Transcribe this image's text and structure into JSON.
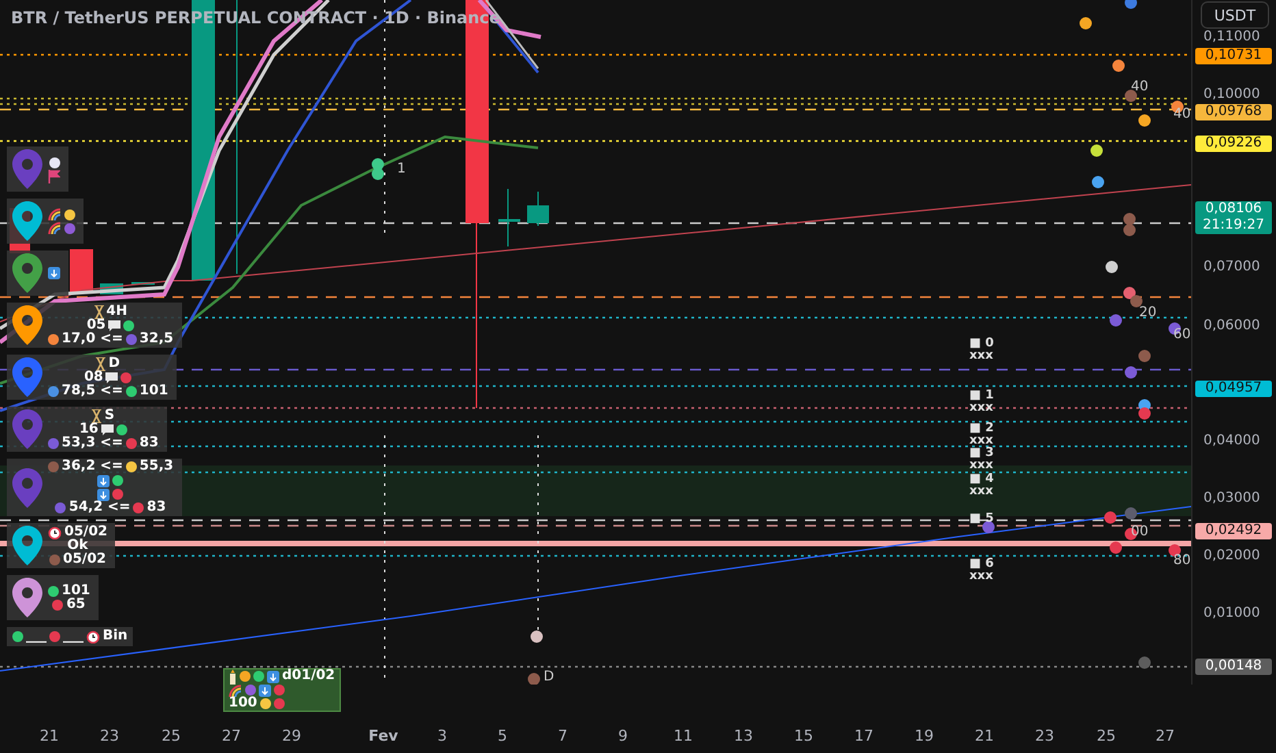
{
  "title": "BTR / TetherUS PERPETUAL CONTRACT · 1D · Binance",
  "currency": "USDT",
  "yticks": [
    "0,11000",
    "0,10000",
    "0,07000",
    "0,06000",
    "0,04000",
    "0,03000",
    "0,02000",
    "0,01000"
  ],
  "price_tags": [
    {
      "text": "0,10731",
      "color": "#ff9800",
      "dark_text": true
    },
    {
      "text": "0,09768",
      "color": "#f6b73c",
      "dark_text": true
    },
    {
      "text": "0,09226",
      "color": "#ffeb3b",
      "dark_text": true
    },
    {
      "text": "0,08106",
      "sub": "21:19:27",
      "color": "#089981",
      "dark_text": false
    },
    {
      "text": "0,04957",
      "color": "#00bcd4",
      "dark_text": true
    },
    {
      "text": "0,02492",
      "color": "#f7a9a8",
      "dark_text": true
    },
    {
      "text": "0,00148",
      "color": "#5d5d5d",
      "dark_text": false
    }
  ],
  "xticks": [
    {
      "label": "21",
      "kind": "day"
    },
    {
      "label": "23",
      "kind": "day"
    },
    {
      "label": "25",
      "kind": "day"
    },
    {
      "label": "27",
      "kind": "day"
    },
    {
      "label": "29",
      "kind": "day"
    },
    {
      "label": "Fev",
      "kind": "month"
    },
    {
      "label": "3",
      "kind": "day"
    },
    {
      "label": "5",
      "kind": "day"
    },
    {
      "label": "7",
      "kind": "day"
    },
    {
      "label": "9",
      "kind": "day"
    },
    {
      "label": "11",
      "kind": "day"
    },
    {
      "label": "13",
      "kind": "day"
    },
    {
      "label": "15",
      "kind": "day"
    },
    {
      "label": "17",
      "kind": "day"
    },
    {
      "label": "19",
      "kind": "day"
    },
    {
      "label": "21",
      "kind": "day"
    },
    {
      "label": "23",
      "kind": "day"
    },
    {
      "label": "25",
      "kind": "day"
    },
    {
      "label": "27",
      "kind": "day"
    }
  ],
  "panels": [
    {
      "color": "#6a3fc0",
      "rows": [
        [
          {
            "kind": "dot",
            "color": "#e6e6f5"
          }
        ],
        [
          {
            "kind": "flag"
          }
        ]
      ]
    },
    {
      "color": "#00bcd4",
      "rows": [
        [
          {
            "kind": "rainbow"
          },
          {
            "kind": "dot",
            "color": "#f5c542"
          }
        ],
        [
          {
            "kind": "rainbow"
          },
          {
            "kind": "dot",
            "color": "#8e5bd6"
          }
        ]
      ]
    },
    {
      "color": "#43a047",
      "rows": [
        [
          {
            "kind": "square"
          }
        ]
      ]
    },
    {
      "color": "#ff9800",
      "rows": [
        [
          {
            "kind": "hourglass"
          },
          {
            "kind": "text",
            "text": "4H"
          }
        ],
        [
          {
            "kind": "text",
            "text": "05"
          },
          {
            "kind": "chat"
          },
          {
            "kind": "dot",
            "color": "#2ecc71"
          }
        ],
        [
          {
            "kind": "dot",
            "color": "#f4843c"
          },
          {
            "kind": "text",
            "text": "17,0 <="
          },
          {
            "kind": "dot",
            "color": "#7b5bd6"
          },
          {
            "kind": "text",
            "text": "32,5"
          }
        ]
      ]
    },
    {
      "color": "#2962ff",
      "rows": [
        [
          {
            "kind": "hourglass"
          },
          {
            "kind": "text",
            "text": "D"
          }
        ],
        [
          {
            "kind": "text",
            "text": "08"
          },
          {
            "kind": "chat"
          },
          {
            "kind": "dot",
            "color": "#e53950"
          }
        ],
        [
          {
            "kind": "dot",
            "color": "#4a90e2"
          },
          {
            "kind": "text",
            "text": "78,5 <="
          },
          {
            "kind": "dot",
            "color": "#2ecc71"
          },
          {
            "kind": "text",
            "text": "101"
          }
        ]
      ]
    },
    {
      "color": "#6a3fc0",
      "rows": [
        [
          {
            "kind": "hourglass"
          },
          {
            "kind": "text",
            "text": "S"
          }
        ],
        [
          {
            "kind": "text",
            "text": "16"
          },
          {
            "kind": "chat"
          },
          {
            "kind": "dot",
            "color": "#2ecc71"
          }
        ],
        [
          {
            "kind": "dot",
            "color": "#7b5bd6"
          },
          {
            "kind": "text",
            "text": "53,3 <="
          },
          {
            "kind": "dot",
            "color": "#e53950"
          },
          {
            "kind": "text",
            "text": "83"
          }
        ]
      ]
    },
    {
      "color": "#6a3fc0",
      "rows": [
        [
          {
            "kind": "dot",
            "color": "#8d5b4c"
          },
          {
            "kind": "text",
            "text": "36,2 <="
          },
          {
            "kind": "dot",
            "color": "#f5c542"
          },
          {
            "kind": "text",
            "text": "55,3"
          }
        ],
        [
          {
            "kind": "square"
          },
          {
            "kind": "dot",
            "color": "#2ecc71"
          }
        ],
        [
          {
            "kind": "square"
          },
          {
            "kind": "dot",
            "color": "#e53950"
          }
        ],
        [
          {
            "kind": "dot",
            "color": "#7b5bd6"
          },
          {
            "kind": "text",
            "text": "54,2 <="
          },
          {
            "kind": "dot",
            "color": "#e53950"
          },
          {
            "kind": "text",
            "text": "83"
          }
        ]
      ]
    },
    {
      "color": "#00bcd4",
      "rows": [
        [
          {
            "kind": "alarm"
          },
          {
            "kind": "text",
            "text": "05/02"
          }
        ],
        [
          {
            "kind": "text",
            "text": "Ok"
          }
        ],
        [
          {
            "kind": "dot",
            "color": "#8d5b4c"
          },
          {
            "kind": "text",
            "text": "05/02"
          }
        ]
      ]
    },
    {
      "color": "#ce93d8",
      "rows": [
        [
          {
            "kind": "dot",
            "color": "#2ecc71"
          },
          {
            "kind": "text",
            "text": "101"
          }
        ],
        [
          {
            "kind": "dot",
            "color": "#e53950"
          },
          {
            "kind": "text",
            "text": "65"
          }
        ]
      ]
    }
  ],
  "legend": [
    {
      "kind": "dot",
      "color": "#2ecc71"
    },
    {
      "kind": "text",
      "text": "___"
    },
    {
      "kind": "dot",
      "color": "#e53950"
    },
    {
      "kind": "text",
      "text": "___"
    },
    {
      "kind": "alarm"
    },
    {
      "kind": "text",
      "text": "Bin"
    }
  ],
  "summary_box": [
    [
      {
        "kind": "candle"
      },
      {
        "kind": "dot",
        "color": "#f5a623"
      },
      {
        "kind": "dot",
        "color": "#2ecc71"
      },
      {
        "kind": "square"
      },
      {
        "kind": "text",
        "text": "d01/02"
      }
    ],
    [
      {
        "kind": "rainbow"
      },
      {
        "kind": "dot",
        "color": "#8e5bd6"
      },
      {
        "kind": "square"
      },
      {
        "kind": "dot",
        "color": "#e53950"
      }
    ],
    [
      {
        "kind": "text",
        "text": "100"
      },
      {
        "kind": "dot",
        "color": "#f5c542"
      },
      {
        "kind": "dot",
        "color": "#e53950"
      }
    ]
  ],
  "level_labels": [
    {
      "label": "■ 0",
      "note": "xxx"
    },
    {
      "label": "■ 1",
      "note": "xxx"
    },
    {
      "label": "■ 2",
      "note": "xxx"
    },
    {
      "label": "■ 3",
      "note": "xxx"
    },
    {
      "label": "■ 4",
      "note": "xxx"
    },
    {
      "label": "■ 5"
    },
    {
      "label": "■ 6",
      "note": "xxx"
    }
  ],
  "chart_labels": [
    {
      "text": "1"
    },
    {
      "text": "40"
    },
    {
      "text": "40"
    },
    {
      "text": "20"
    },
    {
      "text": "60"
    },
    {
      "text": "00"
    },
    {
      "text": "80"
    },
    {
      "text": "D"
    }
  ]
}
